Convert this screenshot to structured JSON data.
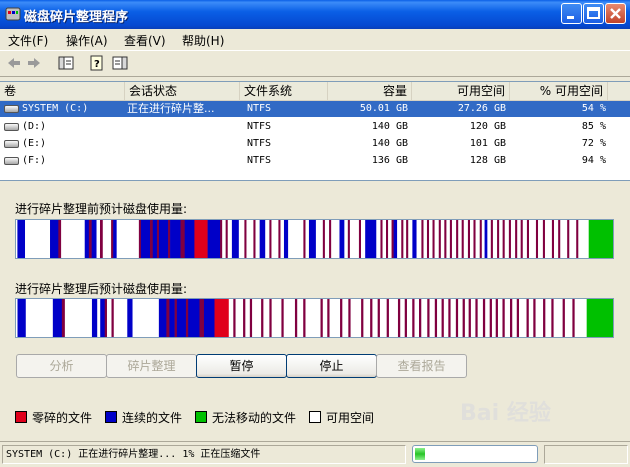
{
  "window": {
    "title": "磁盘碎片整理程序"
  },
  "menu": [
    "文件(F)",
    "操作(A)",
    "查看(V)",
    "帮助(H)"
  ],
  "columns": [
    "卷",
    "会话状态",
    "文件系统",
    "容量",
    "可用空间",
    "% 可用空间"
  ],
  "volumes": [
    {
      "name": "SYSTEM (C:)",
      "status": "正在进行碎片整...",
      "fs": "NTFS",
      "capacity": "50.01 GB",
      "free": "27.26 GB",
      "pct": "54 %",
      "selected": true
    },
    {
      "name": "(D:)",
      "status": "",
      "fs": "NTFS",
      "capacity": "140 GB",
      "free": "120 GB",
      "pct": "85 %"
    },
    {
      "name": "(E:)",
      "status": "",
      "fs": "NTFS",
      "capacity": "140 GB",
      "free": "101 GB",
      "pct": "72 %"
    },
    {
      "name": "(F:)",
      "status": "",
      "fs": "NTFS",
      "capacity": "136 GB",
      "free": "128 GB",
      "pct": "94 %"
    }
  ],
  "before_label": "进行碎片整理前预计磁盘使用量:",
  "after_label": "进行碎片整理后预计磁盘使用量:",
  "colors": {
    "fragmented": "#e0001b",
    "contiguous": "#0000c8",
    "unmovable": "#00c000",
    "free": "#ffffff",
    "extra": "#800040"
  },
  "usage_before": [
    [
      "w",
      0.2
    ],
    [
      "c",
      1.1
    ],
    [
      "w",
      3.6
    ],
    [
      "c",
      1.2
    ],
    [
      "x",
      0.4
    ],
    [
      "w",
      3.4
    ],
    [
      "c",
      0.6
    ],
    [
      "x",
      0.4
    ],
    [
      "c",
      0.7
    ],
    [
      "w",
      0.5
    ],
    [
      "x",
      0.4
    ],
    [
      "w",
      1.2
    ],
    [
      "x",
      0.3
    ],
    [
      "c",
      0.5
    ],
    [
      "w",
      3.2
    ],
    [
      "x",
      0.3
    ],
    [
      "c",
      1.3
    ],
    [
      "x",
      0.4
    ],
    [
      "c",
      0.6
    ],
    [
      "x",
      0.3
    ],
    [
      "c",
      1.3
    ],
    [
      "x",
      0.3
    ],
    [
      "c",
      1.5
    ],
    [
      "x",
      0.6
    ],
    [
      "c",
      1.4
    ],
    [
      "f",
      1.9
    ],
    [
      "c",
      1.8
    ],
    [
      "x",
      0.3
    ],
    [
      "w",
      0.5
    ],
    [
      "x",
      0.3
    ],
    [
      "w",
      0.6
    ],
    [
      "c",
      1.0
    ],
    [
      "w",
      0.8
    ],
    [
      "x",
      0.3
    ],
    [
      "w",
      1.0
    ],
    [
      "x",
      0.3
    ],
    [
      "w",
      0.6
    ],
    [
      "c",
      0.8
    ],
    [
      "w",
      0.6
    ],
    [
      "x",
      0.3
    ],
    [
      "w",
      1.0
    ],
    [
      "x",
      0.3
    ],
    [
      "w",
      0.5
    ],
    [
      "c",
      0.6
    ],
    [
      "w",
      2.2
    ],
    [
      "x",
      0.3
    ],
    [
      "w",
      0.5
    ],
    [
      "c",
      1.0
    ],
    [
      "w",
      1.0
    ],
    [
      "x",
      0.3
    ],
    [
      "w",
      0.6
    ],
    [
      "x",
      0.3
    ],
    [
      "w",
      1.2
    ],
    [
      "c",
      0.7
    ],
    [
      "w",
      0.5
    ],
    [
      "x",
      0.3
    ],
    [
      "w",
      1.3
    ],
    [
      "x",
      0.3
    ],
    [
      "w",
      0.6
    ],
    [
      "c",
      1.6
    ],
    [
      "w",
      0.6
    ],
    [
      "x",
      0.3
    ],
    [
      "w",
      0.5
    ],
    [
      "x",
      0.3
    ],
    [
      "w",
      0.5
    ],
    [
      "x",
      0.3
    ],
    [
      "c",
      0.5
    ],
    [
      "w",
      0.6
    ],
    [
      "x",
      0.3
    ],
    [
      "w",
      0.4
    ],
    [
      "x",
      0.3
    ],
    [
      "w",
      0.6
    ],
    [
      "c",
      0.6
    ],
    [
      "w",
      0.7
    ],
    [
      "x",
      0.3
    ],
    [
      "w",
      0.5
    ],
    [
      "x",
      0.3
    ],
    [
      "w",
      0.5
    ],
    [
      "x",
      0.3
    ],
    [
      "w",
      0.6
    ],
    [
      "x",
      0.3
    ],
    [
      "w",
      0.5
    ],
    [
      "x",
      0.3
    ],
    [
      "w",
      0.5
    ],
    [
      "x",
      0.3
    ],
    [
      "w",
      0.6
    ],
    [
      "x",
      0.3
    ],
    [
      "w",
      0.5
    ],
    [
      "x",
      0.3
    ],
    [
      "w",
      0.6
    ],
    [
      "x",
      0.3
    ],
    [
      "w",
      0.5
    ],
    [
      "x",
      0.3
    ],
    [
      "w",
      0.6
    ],
    [
      "x",
      0.3
    ],
    [
      "w",
      0.4
    ],
    [
      "c",
      0.4
    ],
    [
      "w",
      0.5
    ],
    [
      "x",
      0.3
    ],
    [
      "w",
      0.6
    ],
    [
      "x",
      0.3
    ],
    [
      "w",
      0.5
    ],
    [
      "x",
      0.3
    ],
    [
      "w",
      0.6
    ],
    [
      "x",
      0.3
    ],
    [
      "w",
      0.6
    ],
    [
      "x",
      0.3
    ],
    [
      "w",
      0.5
    ],
    [
      "x",
      0.3
    ],
    [
      "w",
      0.6
    ],
    [
      "x",
      0.3
    ],
    [
      "w",
      1.0
    ],
    [
      "x",
      0.3
    ],
    [
      "w",
      0.7
    ],
    [
      "x",
      0.3
    ],
    [
      "w",
      1.0
    ],
    [
      "x",
      0.3
    ],
    [
      "w",
      0.6
    ],
    [
      "x",
      0.3
    ],
    [
      "w",
      1.0
    ],
    [
      "x",
      0.3
    ],
    [
      "w",
      1.0
    ],
    [
      "x",
      0.3
    ],
    [
      "w",
      1.5
    ],
    [
      "u",
      3.5
    ]
  ],
  "usage_after": [
    [
      "w",
      0.2
    ],
    [
      "c",
      1.1
    ],
    [
      "w",
      3.6
    ],
    [
      "c",
      1.2
    ],
    [
      "x",
      0.4
    ],
    [
      "w",
      3.6
    ],
    [
      "c",
      0.7
    ],
    [
      "w",
      0.4
    ],
    [
      "c",
      0.6
    ],
    [
      "x",
      0.3
    ],
    [
      "w",
      0.6
    ],
    [
      "x",
      0.3
    ],
    [
      "w",
      1.8
    ],
    [
      "c",
      0.7
    ],
    [
      "w",
      3.5
    ],
    [
      "c",
      1.0
    ],
    [
      "x",
      0.4
    ],
    [
      "c",
      0.7
    ],
    [
      "x",
      0.3
    ],
    [
      "c",
      1.2
    ],
    [
      "x",
      0.3
    ],
    [
      "c",
      1.5
    ],
    [
      "x",
      0.6
    ],
    [
      "c",
      1.4
    ],
    [
      "f",
      1.9
    ],
    [
      "w",
      0.6
    ],
    [
      "x",
      0.3
    ],
    [
      "w",
      1.0
    ],
    [
      "x",
      0.3
    ],
    [
      "w",
      0.6
    ],
    [
      "x",
      0.3
    ],
    [
      "w",
      1.2
    ],
    [
      "x",
      0.3
    ],
    [
      "w",
      0.8
    ],
    [
      "x",
      0.3
    ],
    [
      "w",
      1.3
    ],
    [
      "x",
      0.3
    ],
    [
      "w",
      1.5
    ],
    [
      "x",
      0.3
    ],
    [
      "w",
      0.8
    ],
    [
      "x",
      0.3
    ],
    [
      "w",
      2.0
    ],
    [
      "x",
      0.3
    ],
    [
      "w",
      0.6
    ],
    [
      "x",
      0.3
    ],
    [
      "w",
      1.4
    ],
    [
      "x",
      0.3
    ],
    [
      "w",
      0.8
    ],
    [
      "x",
      0.3
    ],
    [
      "w",
      1.4
    ],
    [
      "x",
      0.3
    ],
    [
      "w",
      0.9
    ],
    [
      "x",
      0.3
    ],
    [
      "w",
      0.7
    ],
    [
      "x",
      0.3
    ],
    [
      "w",
      0.9
    ],
    [
      "x",
      0.3
    ],
    [
      "w",
      1.2
    ],
    [
      "x",
      0.3
    ],
    [
      "w",
      0.6
    ],
    [
      "x",
      0.3
    ],
    [
      "w",
      0.7
    ],
    [
      "x",
      0.3
    ],
    [
      "w",
      0.6
    ],
    [
      "x",
      0.3
    ],
    [
      "w",
      0.8
    ],
    [
      "x",
      0.3
    ],
    [
      "w",
      0.7
    ],
    [
      "x",
      0.3
    ],
    [
      "w",
      0.6
    ],
    [
      "x",
      0.3
    ],
    [
      "w",
      0.6
    ],
    [
      "x",
      0.3
    ],
    [
      "w",
      0.7
    ],
    [
      "x",
      0.3
    ],
    [
      "w",
      0.6
    ],
    [
      "x",
      0.3
    ],
    [
      "w",
      0.5
    ],
    [
      "x",
      0.3
    ],
    [
      "w",
      0.6
    ],
    [
      "x",
      0.3
    ],
    [
      "w",
      0.7
    ],
    [
      "x",
      0.3
    ],
    [
      "w",
      0.6
    ],
    [
      "x",
      0.3
    ],
    [
      "w",
      0.5
    ],
    [
      "x",
      0.3
    ],
    [
      "w",
      0.6
    ],
    [
      "x",
      0.3
    ],
    [
      "w",
      0.7
    ],
    [
      "x",
      0.3
    ],
    [
      "w",
      0.6
    ],
    [
      "x",
      0.3
    ],
    [
      "w",
      1.0
    ],
    [
      "x",
      0.3
    ],
    [
      "w",
      0.6
    ],
    [
      "x",
      0.3
    ],
    [
      "w",
      1.0
    ],
    [
      "x",
      0.3
    ],
    [
      "w",
      0.8
    ],
    [
      "x",
      0.3
    ],
    [
      "w",
      1.2
    ],
    [
      "x",
      0.3
    ],
    [
      "w",
      1.0
    ],
    [
      "x",
      0.3
    ],
    [
      "w",
      1.6
    ],
    [
      "u",
      3.5
    ]
  ],
  "buttons": [
    {
      "label": "分析",
      "enabled": false
    },
    {
      "label": "碎片整理",
      "enabled": false
    },
    {
      "label": "暂停",
      "enabled": true
    },
    {
      "label": "停止",
      "enabled": true
    },
    {
      "label": "查看报告",
      "enabled": false
    }
  ],
  "legend": [
    {
      "label": "零碎的文件",
      "color": "#e0001b"
    },
    {
      "label": "连续的文件",
      "color": "#0000c8"
    },
    {
      "label": "无法移动的文件",
      "color": "#00c000"
    },
    {
      "label": "可用空间",
      "color": "#ffffff"
    }
  ],
  "status": {
    "text": "SYSTEM (C:) 正在进行碎片整理... 1%  正在压缩文件",
    "progress": 0.08
  },
  "watermark": "Bai 经验"
}
